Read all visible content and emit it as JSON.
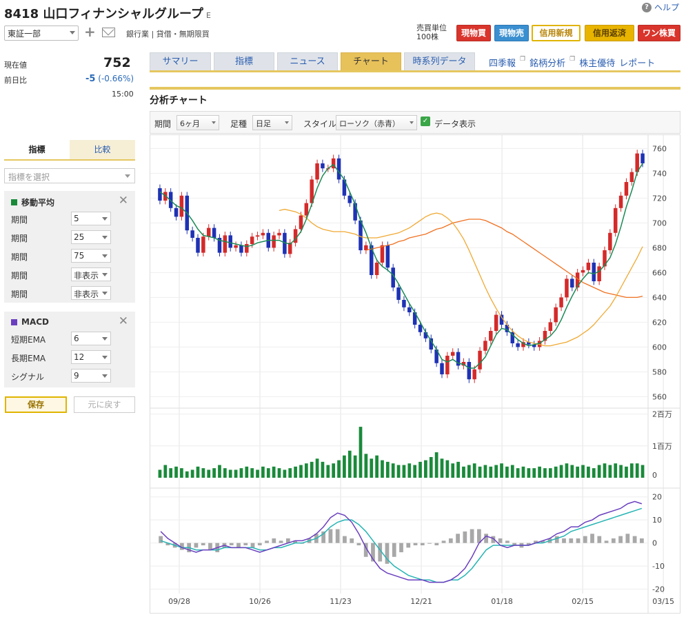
{
  "header": {
    "title": "8418 山口フィナンシャルグループ",
    "title_suffix": "E",
    "help": "ヘルプ",
    "market": "東証一部",
    "industry": "銀行業 | 貸借・無期限買",
    "unit_line1": "売買単位",
    "unit_line2": "100株",
    "buttons": [
      {
        "label": "現物買",
        "color": "#d9352c"
      },
      {
        "label": "現物売",
        "color": "#3a8fd0"
      },
      {
        "label": "信用新規",
        "color": "#e0b400"
      },
      {
        "label": "信用返済",
        "color": "#e8b400"
      },
      {
        "label": "ワン株買",
        "color": "#d9352c"
      }
    ]
  },
  "quote": {
    "current_label": "現在値",
    "current_value": "752",
    "prev_label": "前日比",
    "change": "-5",
    "change_pct": "(-0.66%)",
    "time": "15:00"
  },
  "left_tabs": [
    "指標",
    "比較"
  ],
  "indicator_select_placeholder": "指標を選択",
  "ma_box": {
    "title": "移動平均",
    "color": "#1a8a3a",
    "rows": [
      {
        "label": "期間",
        "value": "5"
      },
      {
        "label": "期間",
        "value": "25"
      },
      {
        "label": "期間",
        "value": "75"
      },
      {
        "label": "期間",
        "value": "非表示"
      },
      {
        "label": "期間",
        "value": "非表示"
      }
    ]
  },
  "macd_box": {
    "title": "MACD",
    "color": "#6a3fbf",
    "rows": [
      {
        "label": "短期EMA",
        "value": "6"
      },
      {
        "label": "長期EMA",
        "value": "12"
      },
      {
        "label": "シグナル",
        "value": "9"
      }
    ]
  },
  "save_label": "保存",
  "reset_label": "元に戻す",
  "tabs": [
    "サマリー",
    "指標",
    "ニュース",
    "チャート",
    "時系列データ"
  ],
  "active_tab": "チャート",
  "right_links": [
    "四季報",
    "銘柄分析",
    "株主優待",
    "レポート"
  ],
  "section_title": "分析チャート",
  "toolbar": {
    "period_label": "期間",
    "period_value": "6ヶ月",
    "type_label": "足種",
    "type_value": "日足",
    "style_label": "スタイル",
    "style_value": "ローソク（赤青）",
    "data_display": "データ表示"
  },
  "chart_data": {
    "type": "candlestick",
    "price_axis": {
      "ticks": [
        560,
        580,
        600,
        620,
        640,
        660,
        680,
        700,
        720,
        740,
        760
      ],
      "ylim": [
        553,
        768
      ]
    },
    "volume_axis": {
      "ticks": [
        "2百万",
        "1百万",
        "0"
      ]
    },
    "macd_axis": {
      "ticks": [
        20,
        10,
        0,
        -10,
        -20
      ],
      "ylim": [
        -21,
        22
      ]
    },
    "x_labels": [
      "09/28",
      "10/26",
      "11/23",
      "12/21",
      "01/18",
      "02/15",
      "03/15"
    ],
    "colors": {
      "up": "#d42a2a",
      "down": "#1e32b4",
      "ma5": "#1a8a55",
      "ma25": "#f0a830",
      "ma75": "#f07020",
      "volume": "#1a8a3a",
      "macd": "#6a3fbf",
      "signal": "#25b4b4",
      "hist": "#a8a8a8"
    },
    "closes": [
      718,
      725,
      712,
      705,
      722,
      694,
      688,
      676,
      689,
      696,
      688,
      676,
      690,
      680,
      682,
      676,
      683,
      689,
      690,
      692,
      680,
      690,
      692,
      675,
      684,
      695,
      706,
      716,
      735,
      748,
      744,
      744,
      752,
      735,
      722,
      716,
      702,
      678,
      682,
      658,
      668,
      682,
      664,
      648,
      638,
      632,
      628,
      618,
      612,
      607,
      598,
      587,
      578,
      593,
      596,
      585,
      588,
      574,
      582,
      597,
      605,
      613,
      626,
      618,
      612,
      603,
      600,
      604,
      602,
      600,
      605,
      613,
      620,
      632,
      640,
      655,
      648,
      660,
      662,
      668,
      653,
      665,
      678,
      692,
      712,
      722,
      733,
      741,
      756,
      748
    ],
    "ma5": [
      725,
      722,
      718,
      714,
      712,
      708,
      702,
      695,
      690,
      689,
      688,
      686,
      685,
      684,
      683,
      682,
      681,
      682,
      684,
      685,
      686,
      686,
      686,
      684,
      683,
      687,
      693,
      703,
      715,
      728,
      738,
      744,
      747,
      741,
      735,
      725,
      715,
      702,
      692,
      680,
      670,
      665,
      662,
      658,
      651,
      643,
      635,
      628,
      620,
      612,
      605,
      598,
      590,
      588,
      590,
      587,
      586,
      583,
      583,
      587,
      592,
      601,
      610,
      615,
      614,
      610,
      606,
      603,
      601,
      602,
      603,
      606,
      609,
      614,
      622,
      632,
      641,
      649,
      655,
      660,
      659,
      661,
      666,
      672,
      683,
      697,
      713,
      726,
      741,
      748
    ],
    "ma25": [
      710,
      711,
      710,
      709,
      707,
      704,
      700,
      697,
      695,
      694,
      693,
      693,
      693,
      692,
      691,
      689,
      688,
      688,
      688,
      689,
      690,
      691,
      692,
      694,
      696,
      699,
      702,
      705,
      707,
      708,
      707,
      704,
      700,
      694,
      687,
      678,
      668,
      658,
      648,
      639,
      631,
      624,
      618,
      613,
      609,
      606,
      604,
      603,
      602,
      601,
      601,
      602,
      603,
      604,
      606,
      608,
      611,
      614,
      618,
      623,
      628,
      633,
      640,
      648,
      656,
      664,
      672,
      681
    ],
    "ma75": [
      678,
      679,
      680,
      681,
      682,
      683,
      685,
      686,
      688,
      689,
      690,
      691,
      693,
      695,
      696,
      698,
      700,
      701,
      702,
      703,
      703,
      703,
      702,
      700,
      698,
      696,
      693,
      691,
      688,
      685,
      682,
      679,
      676,
      673,
      670,
      667,
      664,
      661,
      658,
      655,
      652,
      650,
      648,
      646,
      644,
      643,
      642,
      641,
      640,
      640,
      640,
      641
    ],
    "volume": [
      0.25,
      0.4,
      0.3,
      0.35,
      0.3,
      0.2,
      0.25,
      0.35,
      0.3,
      0.25,
      0.3,
      0.4,
      0.3,
      0.25,
      0.25,
      0.3,
      0.35,
      0.3,
      0.25,
      0.35,
      0.3,
      0.35,
      0.3,
      0.25,
      0.3,
      0.35,
      0.4,
      0.45,
      0.5,
      0.6,
      0.5,
      0.4,
      0.45,
      0.55,
      0.7,
      0.85,
      0.7,
      1.6,
      0.75,
      0.6,
      0.7,
      0.55,
      0.5,
      0.45,
      0.4,
      0.4,
      0.45,
      0.4,
      0.5,
      0.55,
      0.65,
      0.8,
      0.6,
      0.55,
      0.45,
      0.5,
      0.35,
      0.4,
      0.45,
      0.35,
      0.4,
      0.35,
      0.4,
      0.45,
      0.35,
      0.4,
      0.3,
      0.35,
      0.3,
      0.3,
      0.35,
      0.3,
      0.3,
      0.35,
      0.4,
      0.45,
      0.4,
      0.35,
      0.4,
      0.35,
      0.3,
      0.4,
      0.45,
      0.4,
      0.45,
      0.4,
      0.35,
      0.45,
      0.45,
      0.4
    ],
    "macd": [
      5,
      2,
      0,
      -2,
      -3,
      -4,
      -3,
      -3,
      -2,
      -1,
      -2,
      -2,
      -2,
      -3,
      -4,
      -3,
      -2,
      -1,
      0,
      1,
      1,
      2,
      4,
      7,
      11,
      13,
      12,
      9,
      4,
      -2,
      -7,
      -11,
      -13,
      -14,
      -15,
      -16,
      -16,
      -16,
      -17,
      -17,
      -17,
      -16,
      -14,
      -11,
      -6,
      0,
      3,
      2,
      -1,
      -2,
      -1,
      -1,
      -1,
      0,
      1,
      2,
      4,
      5,
      7,
      7,
      9,
      10,
      12,
      13,
      14,
      15,
      17,
      18,
      17
    ],
    "signal": [
      1,
      0,
      -1,
      -2,
      -2,
      -3,
      -3,
      -3,
      -3,
      -2,
      -2,
      -2,
      -2,
      -2,
      -3,
      -3,
      -2,
      -2,
      -1,
      0,
      0,
      1,
      2,
      4,
      7,
      9,
      10,
      10,
      8,
      5,
      1,
      -3,
      -7,
      -10,
      -12,
      -14,
      -15,
      -16,
      -16,
      -17,
      -17,
      -16,
      -16,
      -14,
      -11,
      -7,
      -3,
      -1,
      -1,
      -1,
      -1,
      -1,
      -1,
      0,
      0,
      1,
      2,
      3,
      5,
      6,
      7,
      8,
      9,
      10,
      11,
      12,
      13,
      14,
      15
    ],
    "hist": [
      3,
      -1,
      -2,
      -3,
      -4,
      -2,
      -1,
      -3,
      -4,
      -2,
      -1,
      -2,
      -1,
      -2,
      -1,
      1,
      2,
      1,
      2,
      1,
      0,
      2,
      4,
      5,
      6,
      6,
      3,
      2,
      -1,
      -6,
      -8,
      -8,
      -9,
      -6,
      -4,
      -2,
      -1,
      -1,
      0,
      -1,
      1,
      2,
      4,
      5,
      6,
      6,
      4,
      3,
      2,
      1,
      -1,
      -2,
      -1,
      1,
      1,
      2,
      3,
      2,
      2,
      2,
      3,
      4,
      3,
      1,
      2,
      3,
      4,
      3,
      2
    ]
  }
}
